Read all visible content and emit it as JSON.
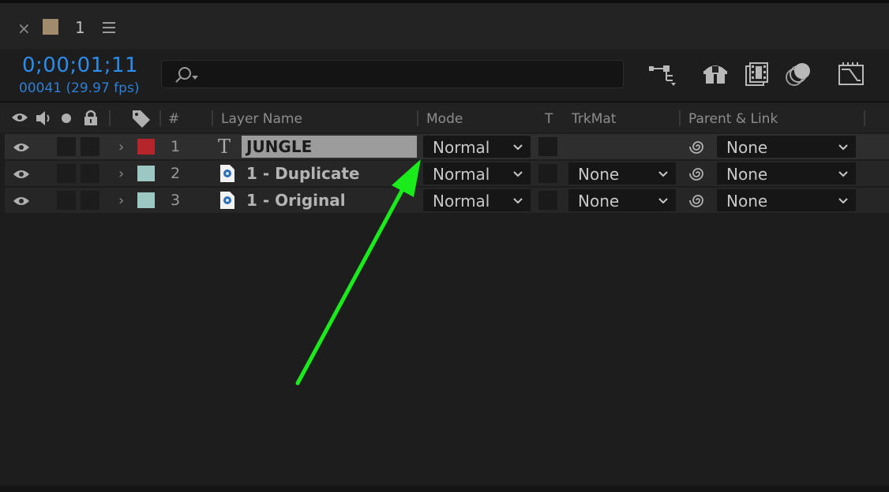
{
  "panel": {
    "close_glyph": "×",
    "comp_color": "#a08b6b",
    "comp_name": "1",
    "menu_icon": "hamburger-menu-icon"
  },
  "time": {
    "timecode": "0;00;01;11",
    "frames": "00041 (29.97 fps)",
    "timecode_color": "#2d8ceb"
  },
  "search": {
    "placeholder": "",
    "icon": "search-icon"
  },
  "toolbar": {
    "icons": [
      "composition-flowchart-icon",
      "draft-3d-icon",
      "frame-blending-icon",
      "motion-blur-icon",
      "graph-editor-icon"
    ]
  },
  "columns": {
    "av_icons": [
      "eye-icon",
      "speaker-icon",
      "solo-dot-icon",
      "lock-icon"
    ],
    "label_icon": "tag-icon",
    "number": "#",
    "layer_name": "Layer Name",
    "mode": "Mode",
    "t": "T",
    "trkmat": "TrkMat",
    "parent": "Parent & Link"
  },
  "layers": [
    {
      "num": "1",
      "name": "JUNGLE",
      "type": "text",
      "label_color": "#b4262b",
      "mode": "Normal",
      "trkmat": "",
      "parent": "None",
      "selected": true,
      "editing": true
    },
    {
      "num": "2",
      "name": "1 - Duplicate",
      "type": "footage",
      "label_color": "#9dc7c3",
      "mode": "Normal",
      "trkmat": "None",
      "parent": "None",
      "selected": false,
      "editing": false
    },
    {
      "num": "3",
      "name": "1 - Original",
      "type": "footage",
      "label_color": "#9dc7c3",
      "mode": "Normal",
      "trkmat": "None",
      "parent": "None",
      "selected": false,
      "editing": false
    }
  ],
  "annotation": {
    "arrow_color": "#1aeb1a",
    "points_to": "mode-column-dropdown"
  }
}
